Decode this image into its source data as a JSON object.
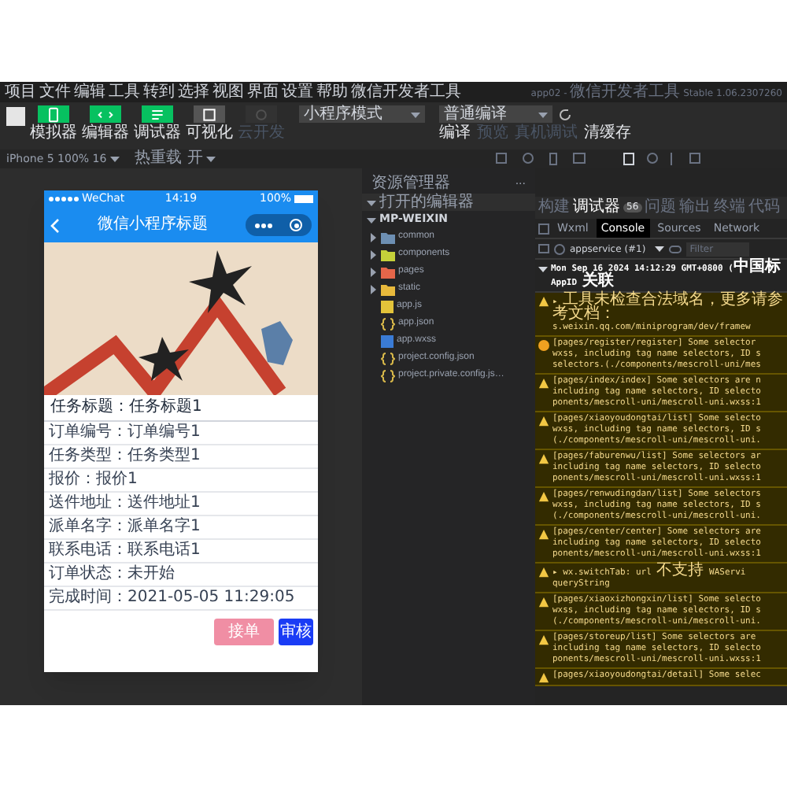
{
  "window": {
    "title": "app02 - 微信开发者工具 Stable 1.06.2307260"
  },
  "menu": [
    "项目",
    "文件",
    "编辑",
    "工具",
    "转到",
    "选择",
    "视图",
    "界面",
    "设置",
    "帮助",
    "微信开发者工具"
  ],
  "toolbar": {
    "modes": [
      {
        "label": "模拟器",
        "selected": true,
        "disabled": false
      },
      {
        "label": "编辑器",
        "selected": true,
        "disabled": false
      },
      {
        "label": "调试器",
        "selected": true,
        "disabled": false
      },
      {
        "label": "可视化",
        "selected": false,
        "disabled": false
      },
      {
        "label": "云开发",
        "selected": false,
        "disabled": true
      }
    ],
    "mode_select": "小程序模式",
    "compile_select": "普通编译",
    "actions": [
      {
        "label": "编译",
        "disabled": false
      },
      {
        "label": "预览",
        "disabled": true
      },
      {
        "label": "真机调试",
        "disabled": true
      },
      {
        "label": "清缓存",
        "disabled": false
      }
    ]
  },
  "simulator": {
    "device": "iPhone 5 100% 16",
    "hot_reload": "热重载 开"
  },
  "phone": {
    "carrier": "WeChat",
    "time": "14:19",
    "battery": "100%",
    "title": "微信小程序标题",
    "heading": {
      "label": "任务标题：",
      "value": "任务标题1"
    },
    "rows": [
      {
        "label": "订单编号：",
        "value": "订单编号1"
      },
      {
        "label": "任务类型：",
        "value": "任务类型1"
      },
      {
        "label": "报价：",
        "value": "报价1"
      },
      {
        "label": "送件地址：",
        "value": "送件地址1"
      },
      {
        "label": "派单名字：",
        "value": "派单名字1"
      },
      {
        "label": "联系电话：",
        "value": "联系电话1"
      },
      {
        "label": "订单状态：",
        "value": "未开始"
      },
      {
        "label": "完成时间：",
        "value": "2021-05-05 11:29:05"
      }
    ],
    "buttons": [
      {
        "label": "接单",
        "kind": "secondary"
      },
      {
        "label": "审核",
        "kind": "primary"
      }
    ]
  },
  "explorer": {
    "title": "资源管理器",
    "more": "···",
    "sections": [
      "打开的编辑器",
      "MP-WEIXIN"
    ],
    "items": [
      {
        "kind": "folder",
        "name": "common",
        "color": "#6d8fb3"
      },
      {
        "kind": "folder",
        "name": "components",
        "color": "#c5d13a"
      },
      {
        "kind": "folder",
        "name": "pages",
        "color": "#e5664a"
      },
      {
        "kind": "folder",
        "name": "static",
        "color": "#e8b93c"
      },
      {
        "kind": "js",
        "name": "app.js"
      },
      {
        "kind": "json",
        "name": "app.json"
      },
      {
        "kind": "wxss",
        "name": "app.wxss"
      },
      {
        "kind": "json",
        "name": "project.config.json"
      },
      {
        "kind": "json",
        "name": "project.private.config.js…"
      }
    ]
  },
  "console": {
    "tabs": [
      {
        "label": "构建",
        "selected": false
      },
      {
        "label": "调试器",
        "selected": true,
        "badge": "56"
      },
      {
        "label": "问题",
        "selected": false
      },
      {
        "label": "输出",
        "selected": false
      },
      {
        "label": "终端",
        "selected": false
      },
      {
        "label": "代码",
        "selected": false
      }
    ],
    "panels": [
      {
        "label": "Wxml",
        "selected": false
      },
      {
        "label": "Console",
        "selected": true
      },
      {
        "label": "Sources",
        "selected": false
      },
      {
        "label": "Network",
        "selected": false
      }
    ],
    "context": "appservice (#1)",
    "filter_placeholder": "Filter",
    "messages": [
      {
        "kind": "group",
        "lines": [
          "Mon Sep 16 2024 14:12:29 GMT+0800 (中国标",
          "AppID 关联"
        ]
      },
      {
        "kind": "warn",
        "lines": [
          "▸ 工具未检查合法域名，更多请参考文档：",
          "s.weixin.qq.com/miniprogram/dev/framew"
        ]
      },
      {
        "kind": "notice",
        "lines": [
          "[pages/register/register] Some selector",
          "wxss, including tag name selectors, ID s",
          "selectors.(./components/mescroll-uni/mes"
        ]
      },
      {
        "kind": "warn",
        "lines": [
          "[pages/index/index] Some selectors are n",
          "including tag name selectors, ID selecto",
          "ponents/mescroll-uni/mescroll-uni.wxss:1"
        ]
      },
      {
        "kind": "warn",
        "lines": [
          "[pages/xiaoyoudongtai/list] Some selecto",
          "wxss, including tag name selectors, ID s",
          "(./components/mescroll-uni/mescroll-uni."
        ]
      },
      {
        "kind": "warn",
        "lines": [
          "[pages/faburenwu/list] Some selectors ar",
          "including tag name selectors, ID selecto",
          "ponents/mescroll-uni/mescroll-uni.wxss:1"
        ]
      },
      {
        "kind": "warn",
        "lines": [
          "[pages/renwudingdan/list] Some selectors",
          "wxss, including tag name selectors, ID s",
          "(./components/mescroll-uni/mescroll-uni."
        ]
      },
      {
        "kind": "warn",
        "lines": [
          "[pages/center/center] Some selectors are",
          "including tag name selectors, ID selecto",
          "ponents/mescroll-uni/mescroll-uni.wxss:1"
        ]
      },
      {
        "kind": "warn",
        "lines": [
          "▸ wx.switchTab: url 不支持   WAServi",
          "queryString"
        ]
      },
      {
        "kind": "warn",
        "lines": [
          "[pages/xiaoxizhongxin/list] Some selecto",
          "wxss, including tag name selectors, ID s",
          "(./components/mescroll-uni/mescroll-uni."
        ]
      },
      {
        "kind": "warn",
        "lines": [
          "[pages/storeup/list] Some selectors are",
          "including tag name selectors, ID selecto",
          "ponents/mescroll-uni/mescroll-uni.wxss:1"
        ]
      },
      {
        "kind": "warn",
        "lines": [
          "[pages/xiaoyoudongtai/detail] Some selec"
        ]
      }
    ]
  }
}
